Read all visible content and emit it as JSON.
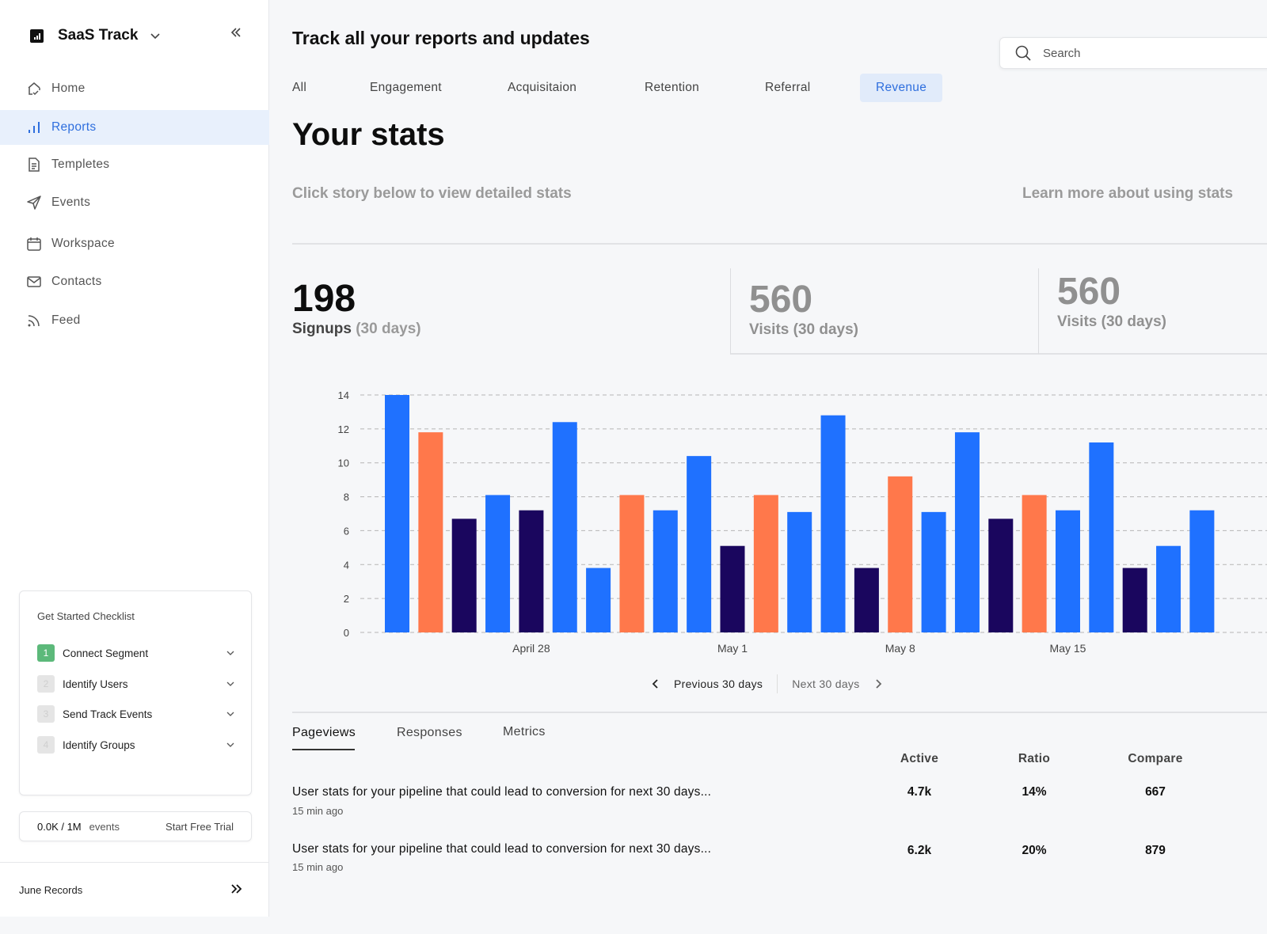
{
  "sidebar": {
    "brand": "SaaS Track",
    "nav": [
      {
        "label": "Home",
        "icon": "home-icon",
        "active": false
      },
      {
        "label": "Reports",
        "icon": "bar-chart-icon",
        "active": true
      },
      {
        "label": "Templetes",
        "icon": "document-icon",
        "active": false
      },
      {
        "label": "Events",
        "icon": "send-icon",
        "active": false
      },
      {
        "label": "Workspace",
        "icon": "calendar-icon",
        "active": false
      },
      {
        "label": "Contacts",
        "icon": "mail-icon",
        "active": false
      },
      {
        "label": "Feed",
        "icon": "rss-icon",
        "active": false
      }
    ],
    "checklist": {
      "title": "Get Started Checklist",
      "items": [
        {
          "num": "1",
          "label": "Connect Segment",
          "done": true
        },
        {
          "num": "2",
          "label": "Identify Users",
          "done": false
        },
        {
          "num": "3",
          "label": "Send Track Events",
          "done": false
        },
        {
          "num": "4",
          "label": "Identify Groups",
          "done": false
        }
      ]
    },
    "events": {
      "count": "0.0K / 1M",
      "unit": "events",
      "trial": "Start Free Trial"
    },
    "footer": "June Records"
  },
  "header": {
    "title": "Track all your reports and updates",
    "search_placeholder": "Search"
  },
  "tabs": [
    {
      "label": "All",
      "active": false
    },
    {
      "label": "Engagement",
      "active": false
    },
    {
      "label": "Acquisitaion",
      "active": false
    },
    {
      "label": "Retention",
      "active": false
    },
    {
      "label": "Referral",
      "active": false
    },
    {
      "label": "Revenue",
      "active": true
    }
  ],
  "stats": {
    "title": "Your stats",
    "subtitle": "Click story below to view detailed stats",
    "learn_more": "Learn more about using stats",
    "kpi_main": {
      "value": "198",
      "label": "Signups",
      "period": "(30 days)"
    },
    "kpi_cards": [
      {
        "value": "560",
        "label": "Visits (30 days)"
      },
      {
        "value": "560",
        "label": "Visits (30 days)"
      }
    ]
  },
  "colors": {
    "blue": "#1f71ff",
    "orange": "#ff784b",
    "navy": "#1a065e",
    "accent": "#2f6fde"
  },
  "chart_data": {
    "type": "bar",
    "title": "",
    "xlabel": "",
    "ylabel": "",
    "ylim": [
      0,
      14
    ],
    "yticks": [
      0,
      2,
      4,
      6,
      8,
      10,
      12,
      14
    ],
    "grid": true,
    "x_tick_labels": [
      {
        "label": "April 28",
        "at_index": 4
      },
      {
        "label": "May 1",
        "at_index": 10
      },
      {
        "label": "May 8",
        "at_index": 15
      },
      {
        "label": "May 15",
        "at_index": 20
      }
    ],
    "values": [
      14,
      11.8,
      6.7,
      8.1,
      7.2,
      12.4,
      3.8,
      8.1,
      7.2,
      10.4,
      5.1,
      8.1,
      7.1,
      12.8,
      3.8,
      9.2,
      7.1,
      11.8,
      6.7,
      8.1,
      7.2,
      11.2,
      3.8,
      5.1,
      7.2
    ],
    "bar_colors": [
      "blue",
      "orange",
      "navy",
      "blue",
      "navy",
      "blue",
      "blue",
      "orange",
      "blue",
      "blue",
      "navy",
      "orange",
      "blue",
      "blue",
      "navy",
      "orange",
      "blue",
      "blue",
      "navy",
      "orange",
      "blue",
      "blue",
      "navy",
      "blue",
      "blue"
    ]
  },
  "pager": {
    "prev": "Previous 30 days",
    "next": "Next 30 days"
  },
  "sub_tabs": [
    {
      "label": "Pageviews",
      "active": true
    },
    {
      "label": "Responses",
      "active": false
    },
    {
      "label": "Metrics",
      "active": false
    }
  ],
  "table": {
    "columns": [
      "Active",
      "Ratio",
      "Compare"
    ],
    "rows": [
      {
        "title": "User stats for your pipeline that could lead to conversion for next 30 days...",
        "time": "15 min ago",
        "active": "4.7k",
        "ratio": "14%",
        "compare": "667"
      },
      {
        "title": "User stats for your pipeline that could lead to conversion for next 30 days...",
        "time": "15 min ago",
        "active": "6.2k",
        "ratio": "20%",
        "compare": "879"
      }
    ]
  }
}
